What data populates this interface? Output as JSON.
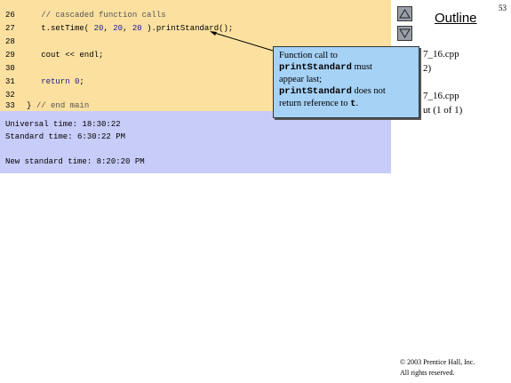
{
  "slide_number": "53",
  "outline": {
    "title": "Outline",
    "up_icon": "triangle-up-icon",
    "down_icon": "triangle-down-icon",
    "items": [
      "7_16.cpp",
      "2)",
      "7_16.cpp",
      "ut (1 of 1)"
    ]
  },
  "code": {
    "lines": [
      {
        "num": "26",
        "parts": [
          {
            "t": "   // cascaded function calls",
            "c": "comment"
          }
        ]
      },
      {
        "num": "27",
        "parts": [
          {
            "t": "   t.setTime( ",
            "c": ""
          },
          {
            "t": "20",
            "c": "num"
          },
          {
            "t": ", ",
            "c": ""
          },
          {
            "t": "20",
            "c": "num"
          },
          {
            "t": ", ",
            "c": ""
          },
          {
            "t": "20",
            "c": "num"
          },
          {
            "t": " ).printStandard();",
            "c": ""
          }
        ]
      },
      {
        "num": "28",
        "parts": []
      },
      {
        "num": "29",
        "parts": [
          {
            "t": "   cout << endl;",
            "c": ""
          }
        ]
      },
      {
        "num": "30",
        "parts": []
      },
      {
        "num": "31",
        "parts": [
          {
            "t": "   ",
            "c": ""
          },
          {
            "t": "return",
            "c": "kw"
          },
          {
            "t": " ",
            "c": ""
          },
          {
            "t": "0",
            "c": "num"
          },
          {
            "t": ";",
            "c": ""
          }
        ]
      },
      {
        "num": "32",
        "parts": []
      },
      {
        "num": "33",
        "parts": [
          {
            "t": "} ",
            "c": ""
          },
          {
            "t": "// end main",
            "c": "comment"
          }
        ]
      }
    ]
  },
  "output": {
    "lines": [
      "Universal time: 18:30:22",
      "Standard time: 6:30:22 PM",
      "",
      "New standard time: 8:20:20 PM"
    ]
  },
  "callout": {
    "line1": "Function call to",
    "line2_code": "printStandard",
    "line2_text": " must",
    "line3": "appear last;",
    "line4_code": "printStandard",
    "line4_text": " does not",
    "line5_text": "return reference to ",
    "line5_code": "t",
    "line5_end": "."
  },
  "copyright": {
    "line1": "© 2003 Prentice Hall, Inc.",
    "line2": "All rights reserved."
  }
}
